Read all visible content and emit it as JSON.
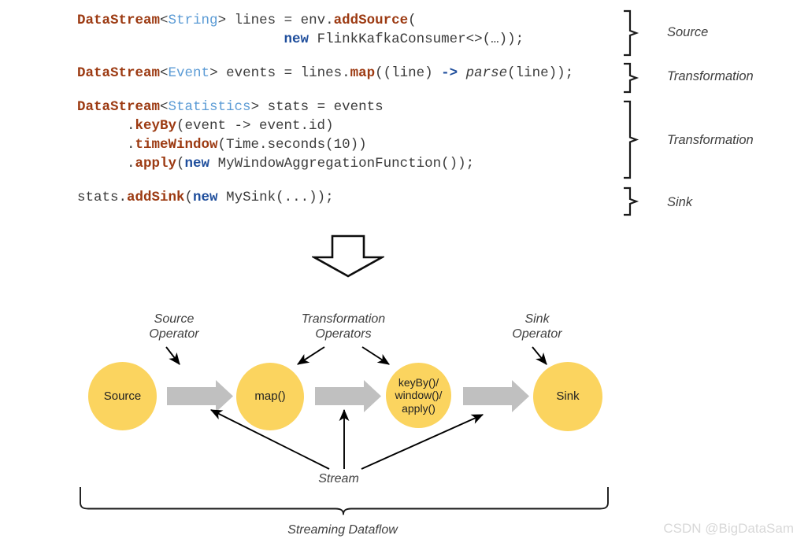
{
  "code": {
    "lines": [
      [
        {
          "t": "DataStream",
          "c": "type"
        },
        {
          "t": "<",
          "c": "plain"
        },
        {
          "t": "String",
          "c": "generic"
        },
        {
          "t": "> lines = env.",
          "c": "plain"
        },
        {
          "t": "addSource",
          "c": "method"
        },
        {
          "t": "(",
          "c": "plain"
        }
      ],
      [
        {
          "t": "                         ",
          "c": "plain"
        },
        {
          "t": "new",
          "c": "kw"
        },
        {
          "t": " FlinkKafkaConsumer<>(…));",
          "c": "plain"
        }
      ],
      [],
      [
        {
          "t": "DataStream",
          "c": "type"
        },
        {
          "t": "<",
          "c": "plain"
        },
        {
          "t": "Event",
          "c": "generic"
        },
        {
          "t": "> events = lines.",
          "c": "plain"
        },
        {
          "t": "map",
          "c": "method"
        },
        {
          "t": "((line) ",
          "c": "plain"
        },
        {
          "t": "->",
          "c": "kw"
        },
        {
          "t": " ",
          "c": "plain"
        },
        {
          "t": "parse",
          "c": "italic"
        },
        {
          "t": "(line));",
          "c": "plain"
        }
      ],
      [],
      [
        {
          "t": "DataStream",
          "c": "type"
        },
        {
          "t": "<",
          "c": "plain"
        },
        {
          "t": "Statistics",
          "c": "generic"
        },
        {
          "t": "> stats = events",
          "c": "plain"
        }
      ],
      [
        {
          "t": "      .",
          "c": "plain"
        },
        {
          "t": "keyBy",
          "c": "method"
        },
        {
          "t": "(event -> event.id)",
          "c": "plain"
        }
      ],
      [
        {
          "t": "      .",
          "c": "plain"
        },
        {
          "t": "timeWindow",
          "c": "method"
        },
        {
          "t": "(Time.seconds(10))",
          "c": "plain"
        }
      ],
      [
        {
          "t": "      .",
          "c": "plain"
        },
        {
          "t": "apply",
          "c": "method"
        },
        {
          "t": "(",
          "c": "plain"
        },
        {
          "t": "new",
          "c": "kw"
        },
        {
          "t": " MyWindowAggregationFunction());",
          "c": "plain"
        }
      ],
      [],
      [
        {
          "t": "stats.",
          "c": "plain"
        },
        {
          "t": "addSink",
          "c": "method"
        },
        {
          "t": "(",
          "c": "plain"
        },
        {
          "t": "new",
          "c": "kw"
        },
        {
          "t": " MySink(...));",
          "c": "plain"
        }
      ]
    ]
  },
  "brace_labels": {
    "source": "Source",
    "transformation_1": "Transformation",
    "transformation_2": "Transformation",
    "sink": "Sink"
  },
  "diagram": {
    "nodes": [
      {
        "id": "source",
        "label": "Source"
      },
      {
        "id": "map",
        "label": "map()"
      },
      {
        "id": "keyby",
        "label": "keyBy()/\nwindow()/\napply()"
      },
      {
        "id": "sink",
        "label": "Sink"
      }
    ],
    "operator_labels": {
      "source_operator": "Source\nOperator",
      "transformation_operators": "Transformation\nOperators",
      "sink_operator": "Sink\nOperator"
    },
    "stream_label": "Stream",
    "dataflow_label": "Streaming Dataflow"
  },
  "watermark": "CSDN @BigDataSam",
  "colors": {
    "node_fill": "#fbd45f",
    "flow_arrow": "#c0c0c0",
    "code_type": "#9c3a12",
    "code_generic": "#5b9bd5",
    "code_keyword": "#1f4e9c",
    "code_plain": "#3b3b3b",
    "line_black": "#000000",
    "watermark": "#d8d8d8"
  }
}
